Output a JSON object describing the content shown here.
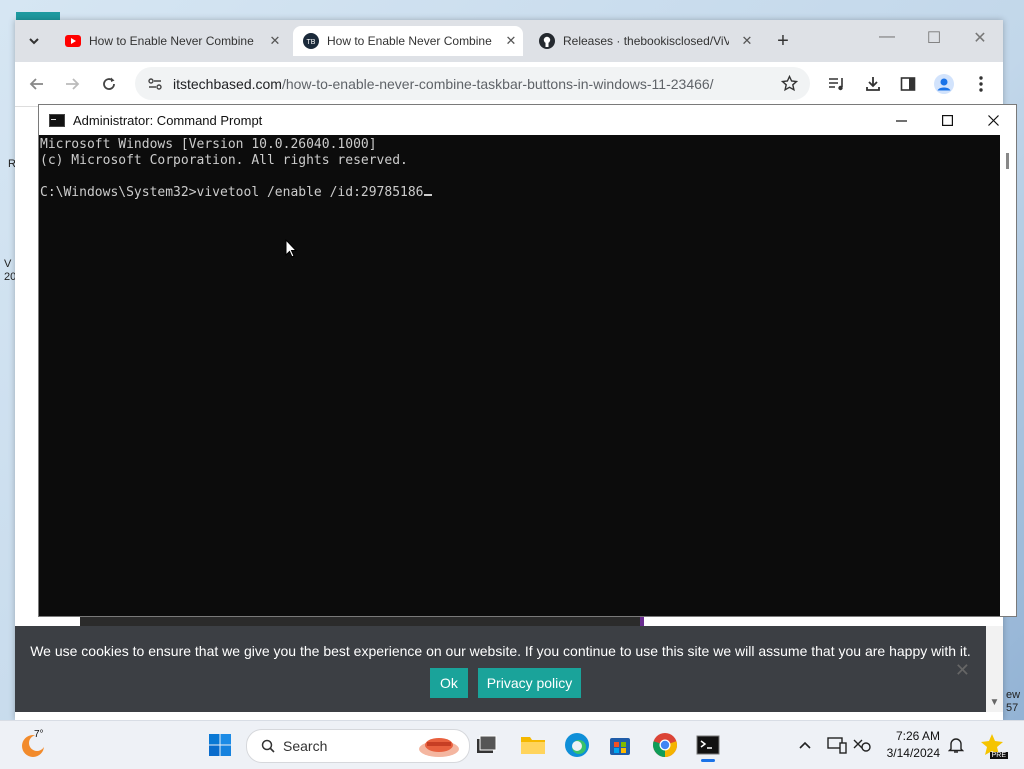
{
  "desktop": {
    "edge_labels": [
      "R",
      "V",
      "20",
      "ew",
      "57"
    ]
  },
  "browser": {
    "tabs": [
      {
        "title": "How to Enable Never Combine",
        "favicon": "youtube-icon",
        "close": "✕"
      },
      {
        "title": "How to Enable Never Combine",
        "favicon": "itstechbased-icon",
        "close": "✕"
      },
      {
        "title": "Releases · thebookisclosed/ViVe",
        "favicon": "github-icon",
        "close": "✕"
      }
    ],
    "new_tab": "+",
    "window_controls": {
      "minimize": "—",
      "maximize": "☐",
      "close": "✕"
    },
    "url_host": "itstechbased.com",
    "url_path": "/how-to-enable-never-combine-taskbar-buttons-in-windows-11-23466/"
  },
  "cmd": {
    "title": "Administrator: Command Prompt",
    "lines": [
      "Microsoft Windows [Version 10.0.26040.1000]",
      "(c) Microsoft Corporation. All rights reserved.",
      "",
      "C:\\Windows\\System32>vivetool /enable /id:29785186"
    ]
  },
  "cookie": {
    "message": "We use cookies to ensure that we give you the best experience on our website. If you continue to use this site we will assume that you are happy with it.",
    "ok_label": "Ok",
    "privacy_label": "Privacy policy",
    "close_label": "✕"
  },
  "taskbar": {
    "weather_temp": "7°",
    "search_placeholder": "Search",
    "time": "7:26 AM",
    "date": "3/14/2024",
    "pre_badge": "PRE"
  },
  "colors": {
    "cookie_button": "#1aa39a",
    "cmd_background": "#0c0c0c",
    "accent_blue": "#1a73e8"
  }
}
